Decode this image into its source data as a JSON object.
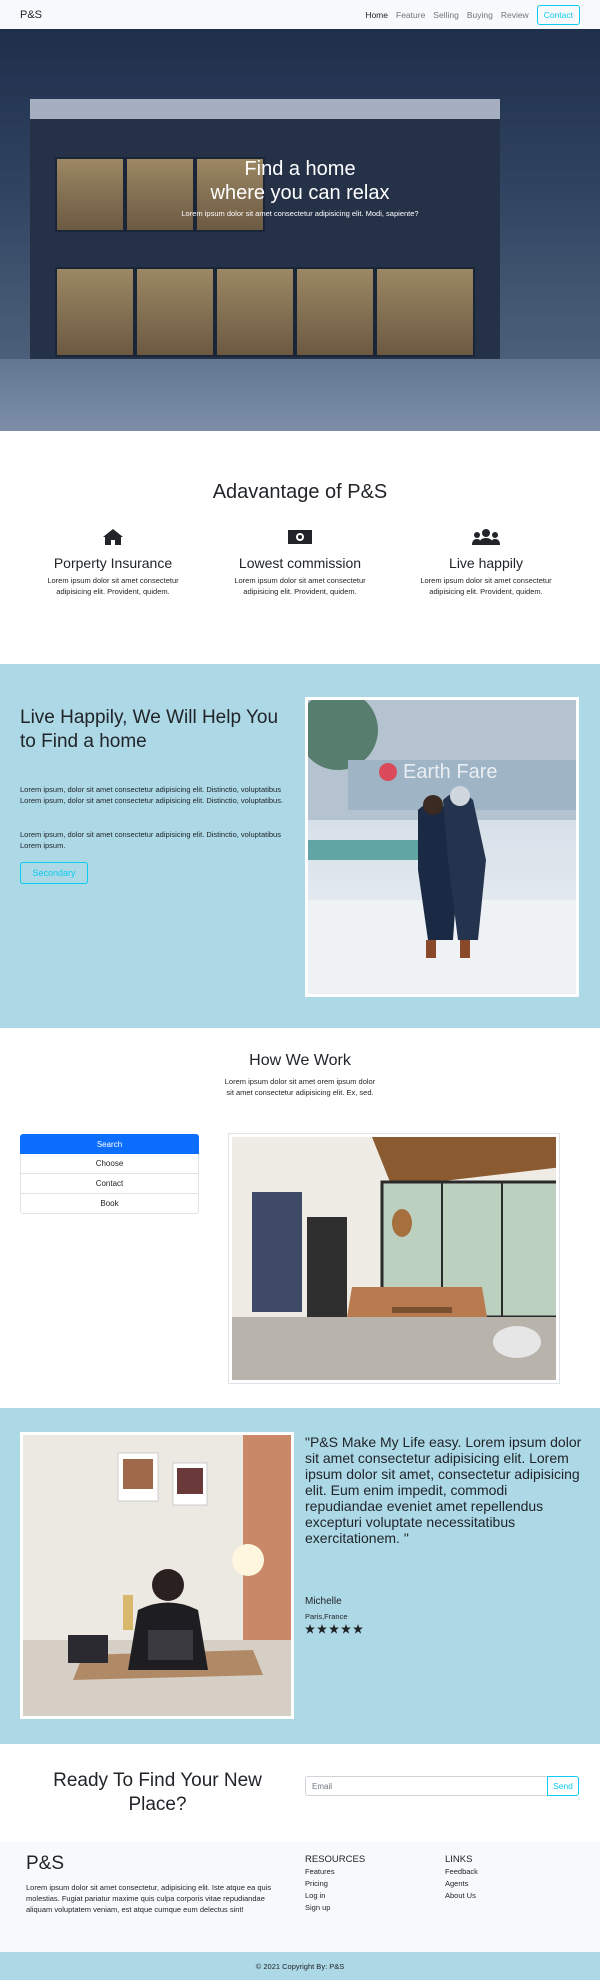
{
  "navbar": {
    "brand": "P&S",
    "links": [
      "Home",
      "Feature",
      "Selling",
      "Buying",
      "Review"
    ],
    "contact": "Contact"
  },
  "hero": {
    "title_line1": "Find a home",
    "title_line2": "where you can relax",
    "subtitle": "Lorem ipsum dolor sit amet consectetur adipisicing elit. Modi, sapiente?"
  },
  "advantage": {
    "title": "Adavantage of P&S",
    "items": [
      {
        "icon": "home-icon",
        "heading": "Porperty Insurance",
        "text": "Lorem ipsum dolor sit amet consectetur adipisicing elit. Provident, quidem."
      },
      {
        "icon": "money-bill-icon",
        "heading": "Lowest commission",
        "text": "Lorem ipsum dolor sit amet consectetur adipisicing elit. Provident, quidem."
      },
      {
        "icon": "users-icon",
        "heading": "Live happily",
        "text": "Lorem ipsum dolor sit amet consectetur adipisicing elit. Provident, quidem."
      }
    ]
  },
  "live": {
    "title": "Live Happily, We Will Help You to Find a home",
    "p1": "Lorem ipsum, dolor sit amet consectetur adipisicing elit. Distinctio, voluptatibus Lorem ipsum, dolor sit amet consectetur adipisicing elit. Distinctio, voluptatibus.",
    "p2": "Lorem ipsum, dolor sit amet consectetur adipisicing elit. Distinctio, voluptatibus Lorem ipsum.",
    "button": "Secondary",
    "photo_sign": "Earth Fare"
  },
  "how": {
    "title": "How We Work",
    "subtitle": "Lorem ipsum dolor sit amet orem ipsum dolor sit amet consectetur adipisicing elit. Ex, sed.",
    "items": [
      "Search",
      "Choose",
      "Contact",
      "Book"
    ]
  },
  "testimonial": {
    "quote": "\"P&S Make My Life easy. Lorem ipsum dolor sit amet consectetur adipisicing elit. Lorem ipsum dolor sit amet, consectetur adipisicing elit. Eum enim impedit, commodi repudiandae eveniet amet repellendus excepturi voluptate necessitatibus exercitationem. \"",
    "name": "Michelle",
    "location": "Paris,France",
    "stars": 5
  },
  "ready": {
    "title": "Ready To Find Your New Place?",
    "placeholder": "Email",
    "send": "Send"
  },
  "footer": {
    "brand": "P&S",
    "text": "Lorem ipsum dolor sit amet consectetur, adipisicing elit. Iste atque ea quis molestias. Fugiat pariatur maxime quis culpa corporis vitae repudiandae aliquam voluptatem veniam, est atque cumque eum delectus sint!",
    "resources": {
      "heading": "RESOURCES",
      "links": [
        "Features",
        "Pricing",
        "Log in",
        "Sign up"
      ]
    },
    "links": {
      "heading": "LINKS",
      "links": [
        "Feedback",
        "Agents",
        "About Us"
      ]
    },
    "copyright": "© 2021 Copyright By: P&S"
  },
  "colors": {
    "accent": "#0dcaf0",
    "primary": "#0d6efd",
    "section_bg": "#add8e6",
    "light_bg": "#f8f9fa"
  }
}
